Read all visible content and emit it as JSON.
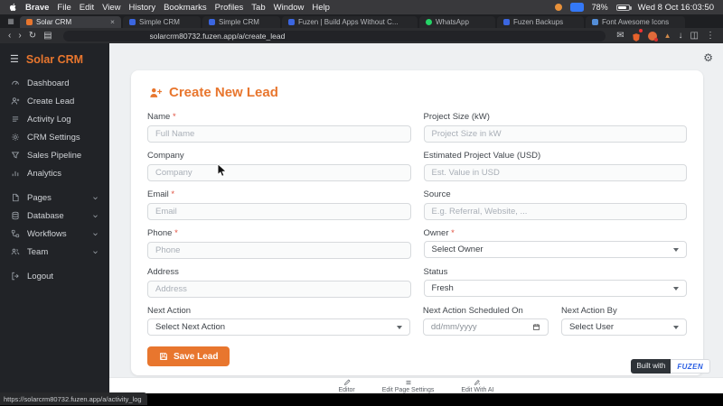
{
  "colors": {
    "accent": "#e8762e",
    "brand_blue": "#2b5fe3"
  },
  "icons": {
    "close": "×",
    "back": "‹",
    "forward": "›",
    "reload": "↻",
    "more": "⋮",
    "download": "↓",
    "split_view": "◫",
    "reading_list": "▤",
    "hamburger": "☰",
    "gear": "⚙",
    "tab_grid": "▦",
    "mail": "✉",
    "rewards": "▲"
  },
  "menubar": {
    "app_name": "Brave",
    "menus": [
      "File",
      "Edit",
      "View",
      "History",
      "Bookmarks",
      "Profiles",
      "Tab",
      "Window",
      "Help"
    ],
    "battery_percent": "78%",
    "clock": "Wed 8 Oct 16:03:50"
  },
  "tabs": [
    {
      "label": "Solar CRM",
      "favicon_color": "#e8762e",
      "active": true
    },
    {
      "label": "Simple CRM",
      "favicon_color": "#3b66e0",
      "active": false
    },
    {
      "label": "Simple CRM",
      "favicon_color": "#3b66e0",
      "active": false
    },
    {
      "label": "Fuzen | Build Apps Without C...",
      "favicon_color": "#3b66e0",
      "active": false
    },
    {
      "label": "WhatsApp",
      "favicon_color": "#25d366",
      "active": false
    },
    {
      "label": "Fuzen Backups",
      "favicon_color": "#3b66e0",
      "active": false
    },
    {
      "label": "Font Awesome Icons",
      "favicon_color": "#538dd7",
      "active": false
    }
  ],
  "toolbar": {
    "url": "solarcrm80732.fuzen.app/a/create_lead"
  },
  "sidebar": {
    "title": "Solar CRM",
    "items": [
      {
        "label": "Dashboard"
      },
      {
        "label": "Create Lead"
      },
      {
        "label": "Activity Log"
      },
      {
        "label": "CRM Settings"
      },
      {
        "label": "Sales Pipeline"
      },
      {
        "label": "Analytics"
      },
      {
        "label": "Pages",
        "expandable": true
      },
      {
        "label": "Database",
        "expandable": true
      },
      {
        "label": "Workflows",
        "expandable": true
      },
      {
        "label": "Team",
        "expandable": true
      },
      {
        "label": "Logout"
      }
    ]
  },
  "page": {
    "title": "Create New Lead",
    "form": {
      "name": {
        "label": "Name",
        "star": " *",
        "placeholder": "Full Name"
      },
      "project_size": {
        "label": "Project Size (kW)",
        "placeholder": "Project Size in kW"
      },
      "company": {
        "label": "Company",
        "placeholder": "Company"
      },
      "est_value": {
        "label": "Estimated Project Value (USD)",
        "placeholder": "Est. Value in USD"
      },
      "email": {
        "label": "Email",
        "star": " *",
        "placeholder": "Email"
      },
      "source": {
        "label": "Source",
        "placeholder": "E.g. Referral, Website, ..."
      },
      "phone": {
        "label": "Phone",
        "star": " *",
        "placeholder": "Phone"
      },
      "owner": {
        "label": "Owner",
        "star": " *",
        "value": "Select Owner"
      },
      "address": {
        "label": "Address",
        "placeholder": "Address"
      },
      "status": {
        "label": "Status",
        "value": "Fresh"
      },
      "next_action": {
        "label": "Next Action",
        "value": "Select Next Action"
      },
      "next_action_on": {
        "label": "Next Action Scheduled On",
        "value": "dd/mm/yyyy"
      },
      "next_action_by": {
        "label": "Next Action By",
        "value": "Select User"
      }
    },
    "save_button": "Save Lead"
  },
  "footer": {
    "items": [
      {
        "label": "Editor"
      },
      {
        "label": "Edit Page Settings"
      },
      {
        "label": "Edit With AI"
      }
    ]
  },
  "badge": {
    "prefix": "Built with",
    "brand": "FUZEN"
  },
  "statusbar": {
    "url": "https://solarcrm80732.fuzen.app/a/activity_log"
  }
}
